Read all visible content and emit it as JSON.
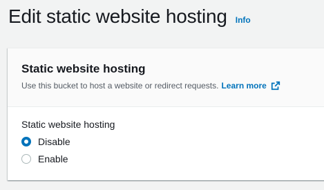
{
  "header": {
    "title": "Edit static website hosting",
    "info_link": "Info"
  },
  "panel": {
    "title": "Static website hosting",
    "description": "Use this bucket to host a website or redirect requests.",
    "learn_more": "Learn more",
    "field_label": "Static website hosting",
    "options": [
      {
        "label": "Disable",
        "selected": true
      },
      {
        "label": "Enable",
        "selected": false
      }
    ]
  },
  "colors": {
    "link": "#0073bb",
    "background": "#f2f3f3",
    "panel_header": "#fafafa"
  },
  "icons": {
    "external_link": "external-link-icon"
  }
}
